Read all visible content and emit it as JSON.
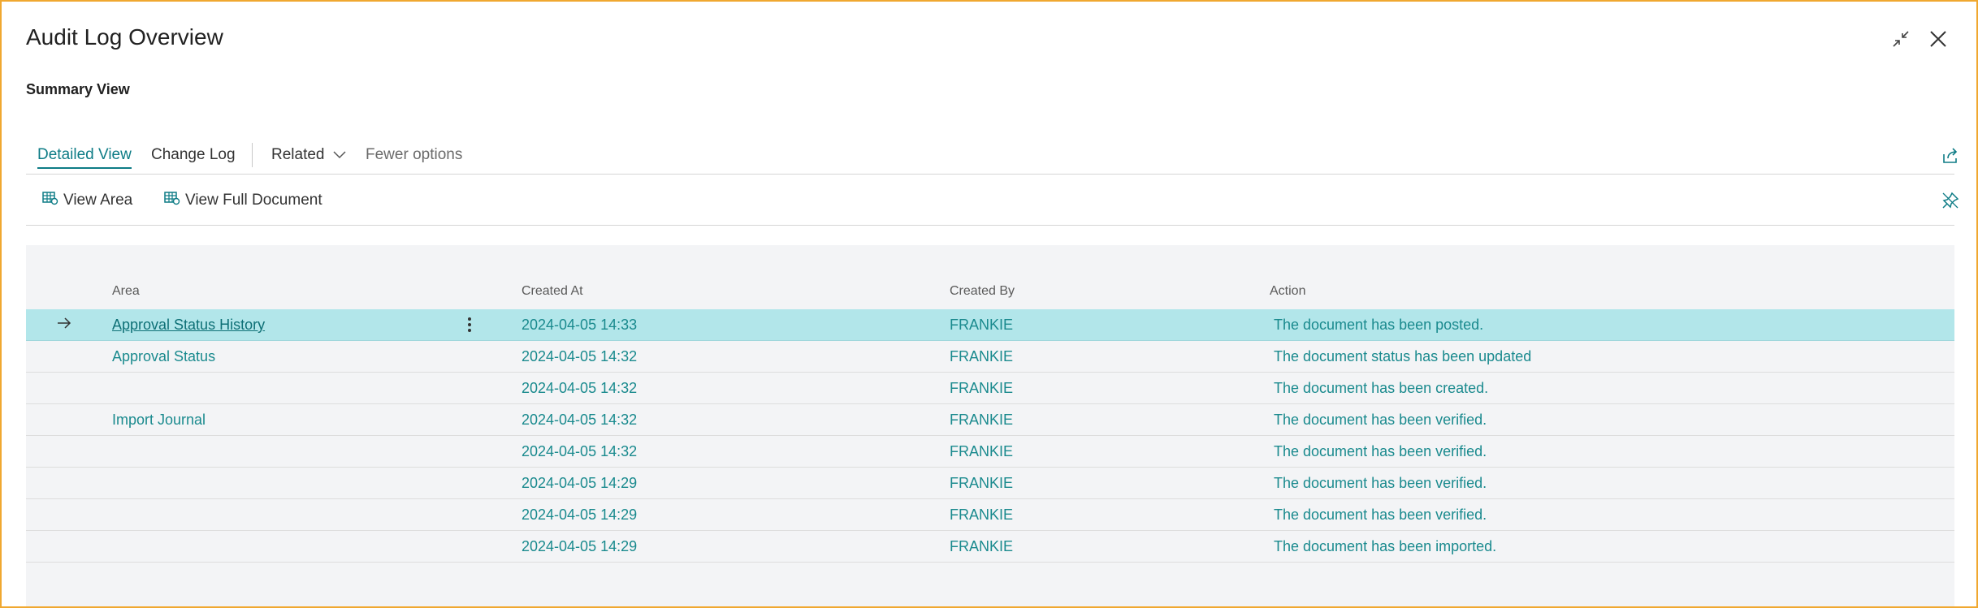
{
  "page": {
    "title": "Audit Log Overview",
    "subtitle": "Summary View"
  },
  "window": {
    "collapse_icon": "collapse-arrows-icon",
    "close_icon": "close-icon"
  },
  "tabs": [
    {
      "label": "Detailed View",
      "active": true
    },
    {
      "label": "Change Log",
      "active": false
    },
    {
      "label": "Related",
      "active": false
    },
    {
      "label": "Fewer options",
      "active": false
    }
  ],
  "actions": [
    {
      "label": "View Area",
      "icon": "table-view-icon"
    },
    {
      "label": "View Full Document",
      "icon": "table-view-icon"
    }
  ],
  "table": {
    "columns": [
      "Area",
      "Created At",
      "Created By",
      "Action"
    ],
    "rows": [
      {
        "area": "Approval Status History",
        "created_at": "2024-04-05 14:33",
        "created_by": "FRANKIE",
        "action": "The document has been posted.",
        "selected": true
      },
      {
        "area": "Approval Status",
        "created_at": "2024-04-05 14:32",
        "created_by": "FRANKIE",
        "action": "The document status has been updated",
        "selected": false
      },
      {
        "area": "",
        "created_at": "2024-04-05 14:32",
        "created_by": "FRANKIE",
        "action": "The document has been created.",
        "selected": false
      },
      {
        "area": "Import Journal",
        "created_at": "2024-04-05 14:32",
        "created_by": "FRANKIE",
        "action": "The document has been verified.",
        "selected": false
      },
      {
        "area": "",
        "created_at": "2024-04-05 14:32",
        "created_by": "FRANKIE",
        "action": "The document has been verified.",
        "selected": false
      },
      {
        "area": "",
        "created_at": "2024-04-05 14:29",
        "created_by": "FRANKIE",
        "action": "The document has been verified.",
        "selected": false
      },
      {
        "area": "",
        "created_at": "2024-04-05 14:29",
        "created_by": "FRANKIE",
        "action": "The document has been verified.",
        "selected": false
      },
      {
        "area": "",
        "created_at": "2024-04-05 14:29",
        "created_by": "FRANKIE",
        "action": "The document has been imported.",
        "selected": false
      }
    ]
  },
  "colors": {
    "accent": "#0e7c86",
    "selected_row": "#b2e6ea",
    "frame_border": "#f0a830",
    "grid_bg": "#f3f4f6"
  }
}
